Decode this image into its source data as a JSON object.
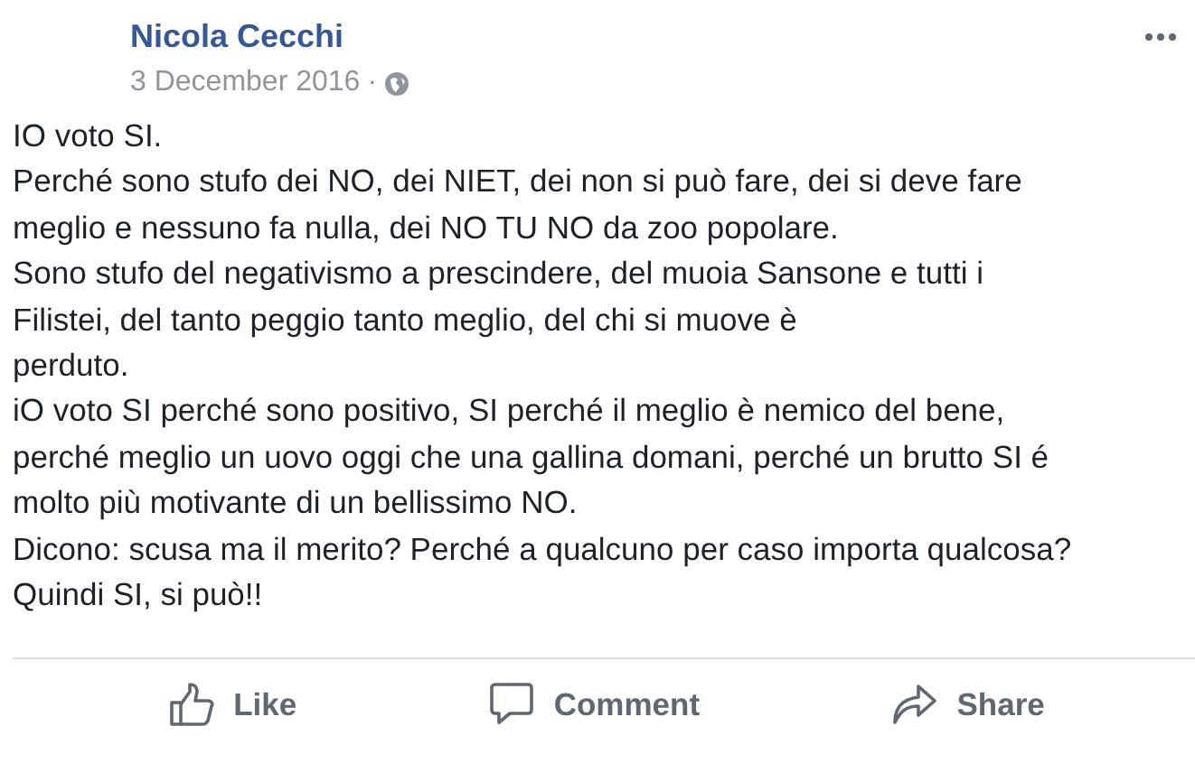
{
  "post": {
    "author": "Nicola Cecchi",
    "date": "3 December 2016",
    "separator": "·",
    "lines": [
      "IO voto SI.",
      "Perché sono stufo dei NO, dei NIET, dei non si può fare, dei si deve fare",
      "meglio e nessuno fa nulla, dei NO TU NO da zoo popolare.",
      "Sono stufo del negativismo a prescindere, del muoia Sansone e tutti i",
      "Filistei, del tanto peggio tanto meglio, del chi si muove è",
      "perduto.",
      "iO voto SI perché sono positivo, SI perché il meglio è nemico del bene,",
      "perché meglio un uovo oggi che una gallina domani, perché un brutto SI é",
      "molto più motivante di un bellissimo NO.",
      "Dicono: scusa ma il merito? Perché a qualcuno per caso importa qualcosa?",
      "Quindi SI, si può!!"
    ]
  },
  "actions": [
    {
      "kind": "like",
      "label": "Like"
    },
    {
      "kind": "comment",
      "label": "Comment"
    },
    {
      "kind": "share",
      "label": "Share"
    }
  ]
}
